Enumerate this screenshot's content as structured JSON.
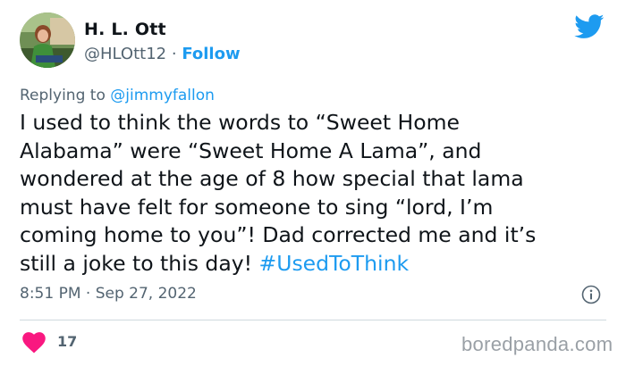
{
  "tweet": {
    "author": {
      "name": "H. L. Ott",
      "handle": "@HLOtt12",
      "separator": "·",
      "follow_label": "Follow"
    },
    "replying_prefix": "Replying to",
    "replying_to": "@jimmyfallon",
    "body_lines": [
      "I used to think the words to “Sweet Home",
      "Alabama” were “Sweet Home A Lama”, and",
      "wondered at the age of 8 how special that lama",
      "must have felt for someone to sing “lord, I’m",
      "coming home to you”!   Dad corrected me and it’s",
      "still a joke to this day!"
    ],
    "hashtag": "#UsedToThink",
    "time": "8:51 PM",
    "date_separator": "·",
    "date": "Sep 27, 2022",
    "likes": "17"
  },
  "watermark": "boredpanda.com",
  "icons": {
    "brand": "twitter-bird-icon",
    "info": "info-icon",
    "like": "heart-icon"
  },
  "colors": {
    "accent": "#1d9bf0",
    "like": "#f91880",
    "muted_text": "#536471"
  }
}
